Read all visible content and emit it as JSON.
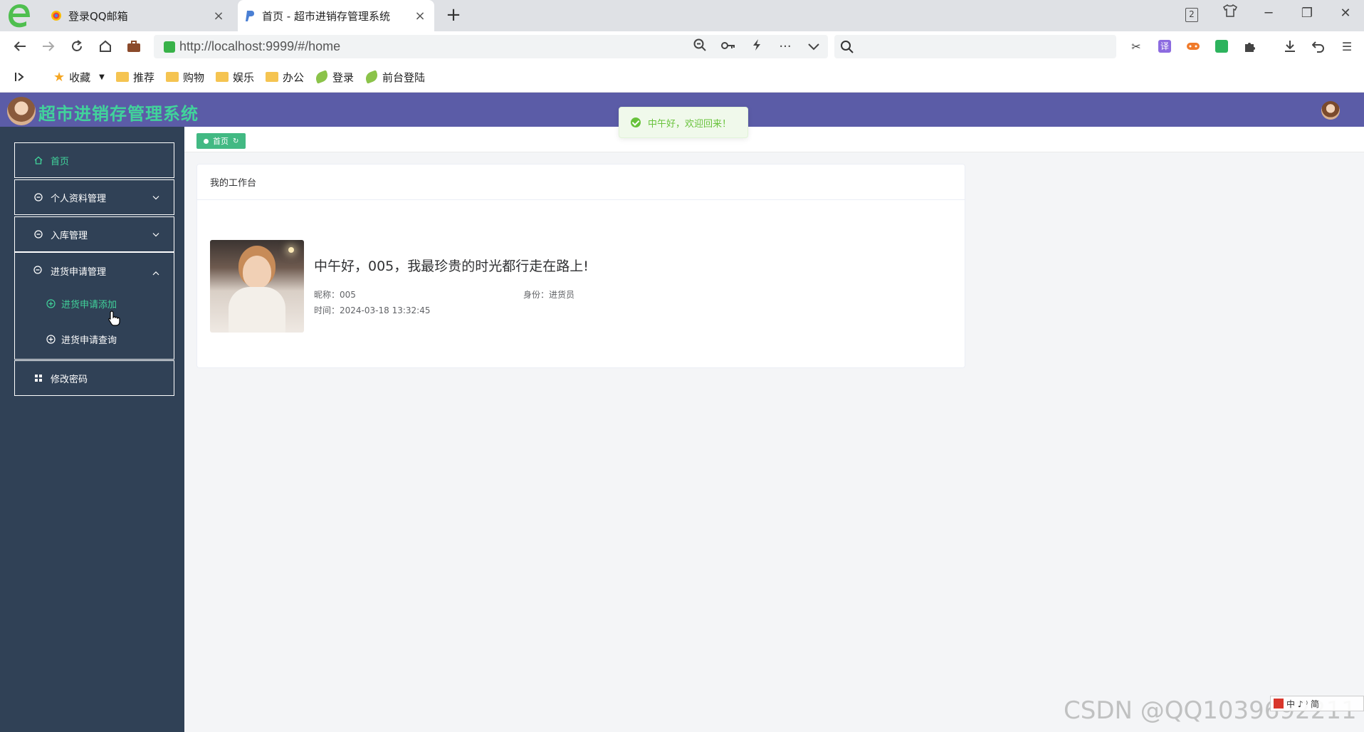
{
  "browser": {
    "tabs": [
      {
        "title": "登录QQ邮箱",
        "close": "×"
      },
      {
        "title": "首页 - 超市进销存管理系统",
        "close": "×"
      }
    ],
    "new_tab": "+",
    "tab_count_badge": "2",
    "url": "http://localhost:9999/#/home",
    "bookmarks": [
      {
        "label": "收藏",
        "icon": "star-icon"
      },
      {
        "label": "推荐",
        "icon": "folder-icon"
      },
      {
        "label": "购物",
        "icon": "folder-icon"
      },
      {
        "label": "娱乐",
        "icon": "folder-icon"
      },
      {
        "label": "办公",
        "icon": "folder-icon"
      },
      {
        "label": "登录",
        "icon": "leaf-icon"
      },
      {
        "label": "前台登陆",
        "icon": "leaf-icon"
      }
    ]
  },
  "app": {
    "title": "超市进销存管理系统",
    "accent_color": "#41d39b",
    "header_color": "#5b5ca7",
    "sidebar_color": "#304156"
  },
  "toast": {
    "message": "中午好，欢迎回来！",
    "color": "#67c23a"
  },
  "sidebar": {
    "home": "首页",
    "profile": "个人资料管理",
    "inbound": "入库管理",
    "purchase": {
      "label": "进货申请管理",
      "children": [
        "进货申请添加",
        "进货申请查询"
      ]
    },
    "password": "修改密码"
  },
  "tags": [
    {
      "label": "首页"
    }
  ],
  "workbench": {
    "header": "我的工作台",
    "greeting": "中午好，005，我最珍贵的时光都行走在路上!",
    "nickname_label": "昵称：",
    "nickname": "005",
    "role_label": "身份：",
    "role": "进货员",
    "time_label": "时间：",
    "time": "2024-03-18 13:32:45"
  },
  "watermark": "CSDN @QQ1039692211",
  "ime": {
    "text": "中 ♪ ⁾ 简"
  }
}
